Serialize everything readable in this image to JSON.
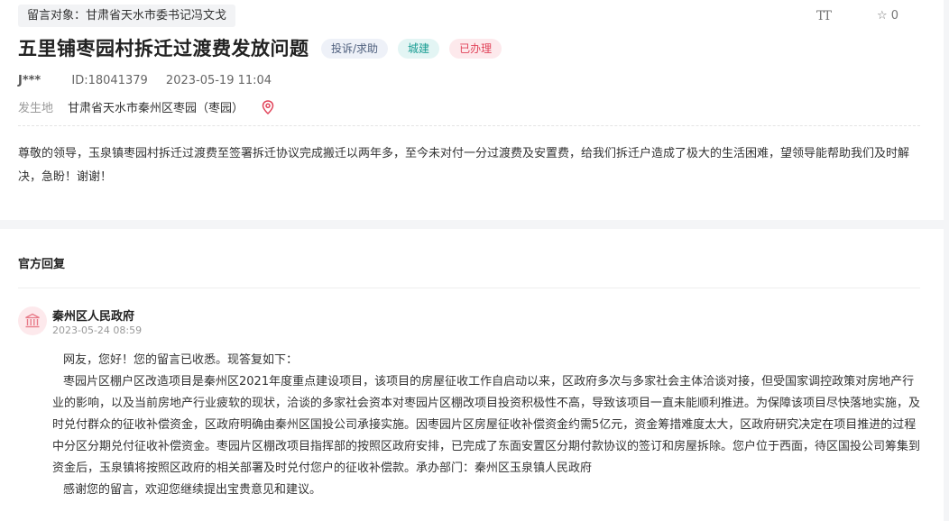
{
  "message": {
    "target": "留言对象：甘肃省天水市委书记冯文戈",
    "font_icon": "TT",
    "star_count": "0",
    "title": "五里铺枣园村拆迁过渡费发放问题",
    "badges": {
      "type": "投诉/求助",
      "category": "城建",
      "status": "已办理"
    },
    "author": "J***",
    "id": "ID:18041379",
    "datetime": "2023-05-19 11:04",
    "location_label": "发生地",
    "location": "甘肃省天水市秦州区枣园（枣园）",
    "content": "尊敬的领导，玉泉镇枣园村拆迁过渡费至签署拆迁协议完成搬迁以两年多，至今未对付一分过渡费及安置费，给我们拆迁户造成了极大的生活困难，望领导能帮助我们及时解决，急盼！谢谢！"
  },
  "reply": {
    "section_title": "官方回复",
    "org": "秦州区人民政府",
    "date": "2023-05-24 08:59",
    "paragraphs": [
      "网友，您好！您的留言已收悉。现答复如下：",
      "枣园片区棚户区改造项目是秦州区2021年度重点建设项目，该项目的房屋征收工作自启动以来，区政府多次与多家社会主体洽谈对接，但受国家调控政策对房地产行业的影响，以及当前房地产行业疲软的现状，洽谈的多家社会资本对枣园片区棚改项目投资积极性不高，导致该项目一直未能顺利推进。为保障该项目尽快落地实施，及时兑付群众的征收补偿资金，区政府明确由秦州区国投公司承接实施。因枣园片区房屋征收补偿资金约需5亿元，资金筹措难度太大，区政府研究决定在项目推进的过程中分区分期兑付征收补偿资金。枣园片区棚改项目指挥部的按照区政府安排，已完成了东面安置区分期付款协议的签订和房屋拆除。您户位于西面，待区国投公司筹集到资金后，玉泉镇将按照区政府的相关部署及时兑付您户的征收补偿款。承办部门：秦州区玉泉镇人民政府",
      "感谢您的留言，欢迎您继续提出宝贵意见和建议。"
    ]
  },
  "icons": {
    "font": "font-size-icon",
    "star": "star-icon",
    "pin": "location-pin-icon",
    "org": "government-building-icon"
  },
  "colors": {
    "status_red": "#e1445a",
    "category_teal": "#1a9d93",
    "type_navy": "#4e5f7d"
  }
}
